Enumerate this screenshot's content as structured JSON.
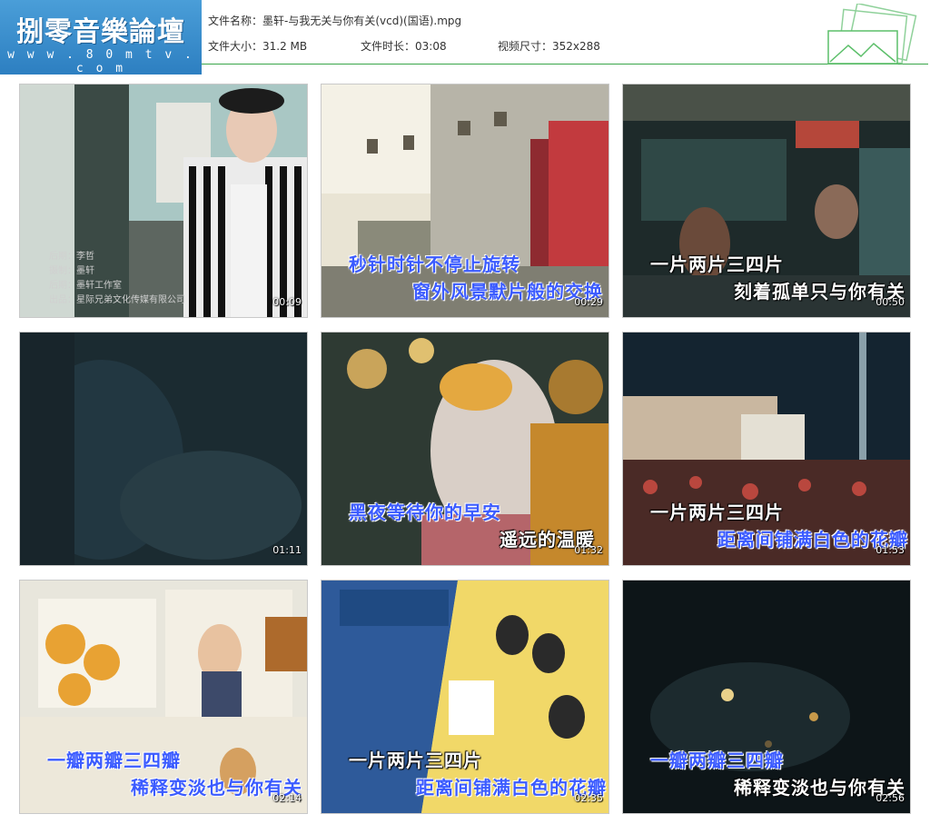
{
  "logo": {
    "title": "捌零音樂論壇",
    "url": "w w w . 8 0 m t v . c o m"
  },
  "file_info": {
    "name_label": "文件名称：",
    "name_value": "墨轩-与我无关与你有关(vcd)(国语).mpg",
    "size_label": "文件大小：",
    "size_value": "31.2 MB",
    "duration_label": "文件时长：",
    "duration_value": "03:08",
    "dimensions_label": "视频尺寸：",
    "dimensions_value": "352x288"
  },
  "thumbnails": [
    {
      "time": "00:09",
      "credits": [
        "后期：李哲",
        "摄制：墨轩",
        "后期：墨轩工作室",
        "出品：星际兄弟文化传媒有限公司"
      ],
      "lyrics": []
    },
    {
      "time": "00:29",
      "lyrics": [
        "秒针时针不停止旋转",
        "窗外风景默片般的交换"
      ]
    },
    {
      "time": "00:50",
      "lyrics": [
        "一片两片三四片",
        "刻着孤单只与你有关"
      ]
    },
    {
      "time": "01:11",
      "lyrics": []
    },
    {
      "time": "01:32",
      "lyrics": [
        "黑夜等待你的早安",
        "遥远的温暖"
      ]
    },
    {
      "time": "01:53",
      "lyrics": [
        "一片两片三四片",
        "距离间铺满白色的花瓣"
      ]
    },
    {
      "time": "02:14",
      "lyrics": [
        "一瓣两瓣三四瓣",
        "稀释变淡也与你有关"
      ]
    },
    {
      "time": "02:35",
      "lyrics": [
        "一片两片三四片",
        "距离间铺满白色的花瓣"
      ]
    },
    {
      "time": "02:56",
      "lyrics": [
        "一瓣两瓣三四瓣",
        "稀释变淡也与你有关"
      ]
    }
  ],
  "colors": {
    "accent_green": "#3aa64a",
    "logo_blue": "#2d7fc1",
    "lyric_blue": "#3b5bff"
  },
  "icons": {
    "header_decoration": "green-folders-icon"
  }
}
